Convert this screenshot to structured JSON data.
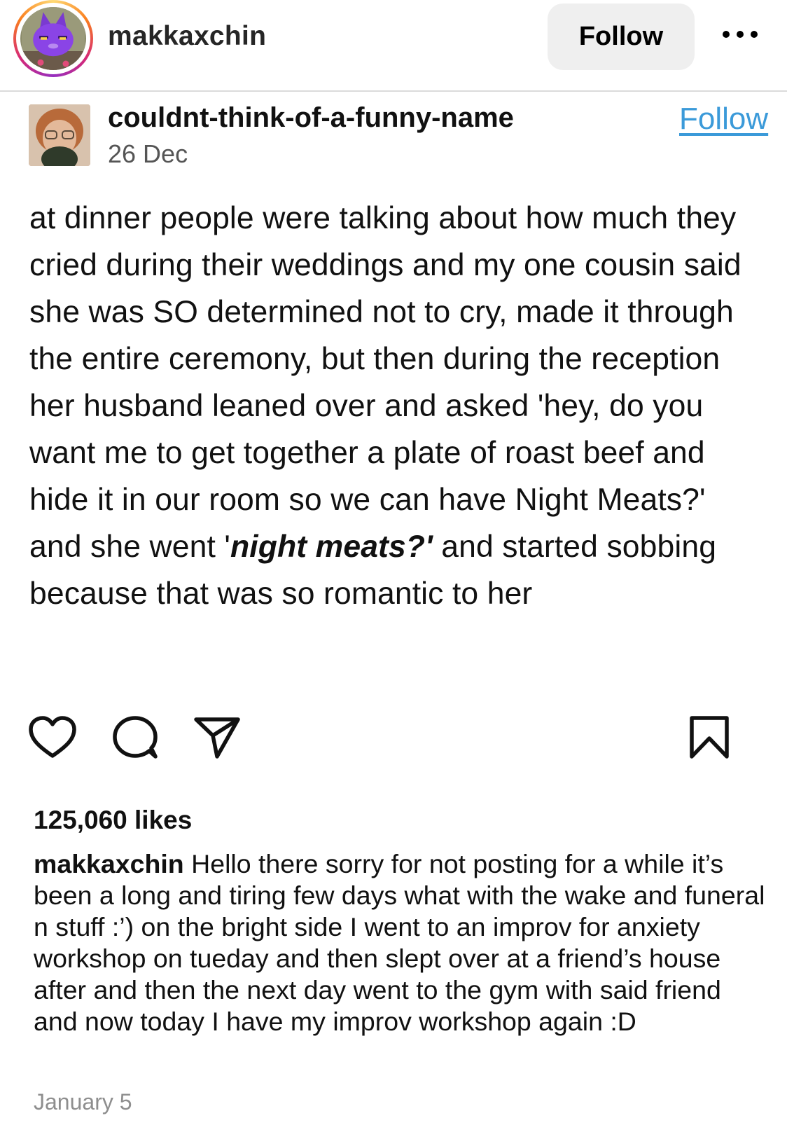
{
  "header": {
    "username": "makkaxchin",
    "follow_label": "Follow",
    "avatar_icon": "purple-cat-avatar-icon",
    "more_icon": "more-options-icon"
  },
  "repost": {
    "username": "couldnt-think-of-a-funny-name",
    "date": "26 Dec",
    "follow_label": "Follow",
    "body": {
      "part1": "at dinner people were talking about how much they cried during their weddings and my one cousin said she was SO determined not to cry, made it through the entire ceremony, but then during the reception her husband leaned over and asked 'hey, do you want me to get together a plate of roast beef and hide it in our room so we can have Night Meats?' and she went '",
      "emphasis": "night meats?'",
      "part2": " and started sobbing because that was so romantic to her"
    }
  },
  "actions": {
    "like_icon": "heart-icon",
    "comment_icon": "comment-icon",
    "share_icon": "share-icon",
    "save_icon": "bookmark-icon"
  },
  "likes": "125,060 likes",
  "caption": {
    "username": "makkaxchin",
    "text": " Hello there sorry for not posting for a while it’s been a long and tiring few days what with the wake and funeral n stuff :’) on the bright side I went to an improv for anxiety workshop on tueday and then slept over at a friend’s house after and then the next day went to the gym with said friend and now today I have my improv workshop again :D"
  },
  "post_date": "January 5",
  "colors": {
    "tumblr_link": "#3b9ad9",
    "button_bg": "#efefef",
    "muted_text": "#8e8e8e"
  }
}
